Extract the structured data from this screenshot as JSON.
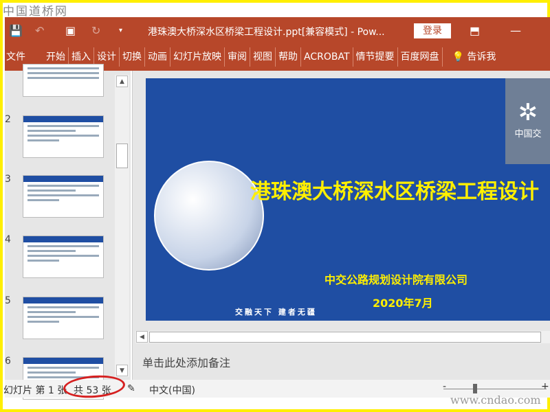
{
  "watermark_top": "中国道桥网",
  "watermark_bottom": "www.cndao.com",
  "titlebar": {
    "title": "港珠澳大桥深水区桥梁工程设计.ppt[兼容模式]  -  Pow...",
    "login": "登录",
    "minimize": "—"
  },
  "ribbon": {
    "tabs": [
      "文件",
      "开始",
      "插入",
      "设计",
      "切换",
      "动画",
      "幻灯片放映",
      "审阅",
      "视图",
      "帮助",
      "ACROBAT",
      "情节提要",
      "百度网盘"
    ],
    "tell_me": "告诉我"
  },
  "thumbnails": {
    "numbers": [
      "2",
      "3",
      "4",
      "5",
      "6"
    ]
  },
  "slide": {
    "title": "港珠澳大桥深水区桥梁工程设计",
    "organization": "中交公路规划设计院有限公司",
    "date": "2020年7月",
    "motto": "交融天下  建者无疆",
    "logo_text": "中国交"
  },
  "notes": {
    "placeholder": "单击此处添加备注"
  },
  "status": {
    "slide_position": "幻灯片 第 1 张",
    "total": "共 53 张",
    "language": "中文(中国)",
    "zoom_minus": "-",
    "zoom_plus": "+"
  },
  "colors": {
    "accent": "#b7472a",
    "slide_bg": "#1f4ea3",
    "title_yellow": "#ffef00",
    "highlight": "#d62020"
  }
}
